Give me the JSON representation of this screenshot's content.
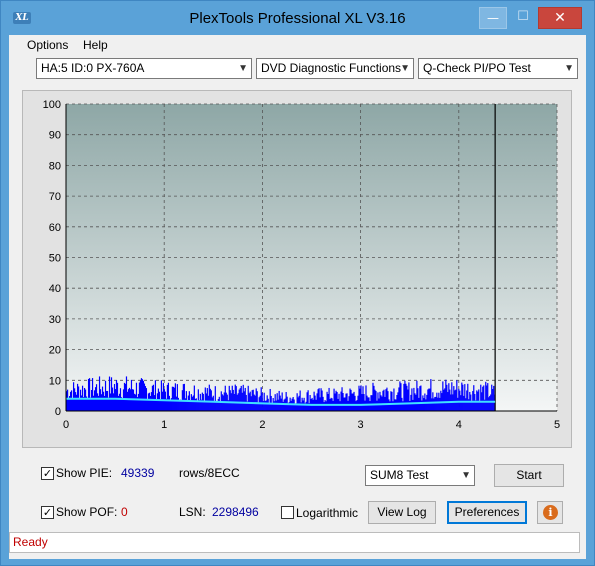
{
  "window": {
    "title": "PlexTools Professional XL V3.16",
    "icon_label": "XL",
    "controls": {
      "minimize": "—",
      "maximize": "☐",
      "close": "✕"
    }
  },
  "menu": {
    "options": "Options",
    "help": "Help"
  },
  "toolbar": {
    "drive": "HA:5 ID:0  PX-760A",
    "function": "DVD Diagnostic Functions",
    "test": "Q-Check PI/PO Test"
  },
  "chart_data": {
    "type": "bar",
    "title": "",
    "xlabel": "",
    "ylabel": "",
    "xlim": [
      0,
      5
    ],
    "ylim": [
      0,
      100
    ],
    "x_ticks": [
      "0",
      "1",
      "2",
      "3",
      "4",
      "5"
    ],
    "y_ticks": [
      "0",
      "10",
      "20",
      "30",
      "40",
      "50",
      "60",
      "70",
      "80",
      "90",
      "100"
    ],
    "grid": true,
    "data_end_x": 4.37,
    "series": [
      {
        "kind": "PIE bars",
        "color": "#0000ff",
        "x": [
          0,
          0.25,
          0.5,
          0.75,
          1.0,
          1.25,
          1.5,
          1.75,
          2.0,
          2.25,
          2.5,
          2.75,
          3.0,
          3.25,
          3.5,
          3.75,
          4.0,
          4.25,
          4.37
        ],
        "values": [
          9,
          10,
          11,
          10,
          9,
          9,
          8,
          8,
          7,
          6,
          7,
          7,
          8,
          9,
          9,
          10,
          10,
          9,
          8
        ]
      },
      {
        "kind": "PIE line",
        "color": "#40e0ff",
        "x": [
          0,
          0.5,
          1.0,
          1.5,
          2.0,
          2.5,
          3.0,
          3.5,
          4.0,
          4.37
        ],
        "values": [
          4,
          4,
          3.5,
          3,
          2.5,
          2,
          2,
          2.5,
          3,
          3
        ]
      }
    ]
  },
  "controls": {
    "show_pie_label": "Show PIE:",
    "show_pie_checked": "✓",
    "pie_value": "49339",
    "pie_unit": "rows/8ECC",
    "show_pof_label": "Show POF:",
    "show_pof_checked": "✓",
    "pof_value": "0",
    "lsn_label": "LSN:",
    "lsn_value": "2298496",
    "logarithmic_label": "Logarithmic",
    "sum_select": "SUM8 Test",
    "start_button": "Start",
    "view_log_button": "View Log",
    "preferences_button": "Preferences",
    "info_icon": "i"
  },
  "status": {
    "text": "Ready"
  }
}
